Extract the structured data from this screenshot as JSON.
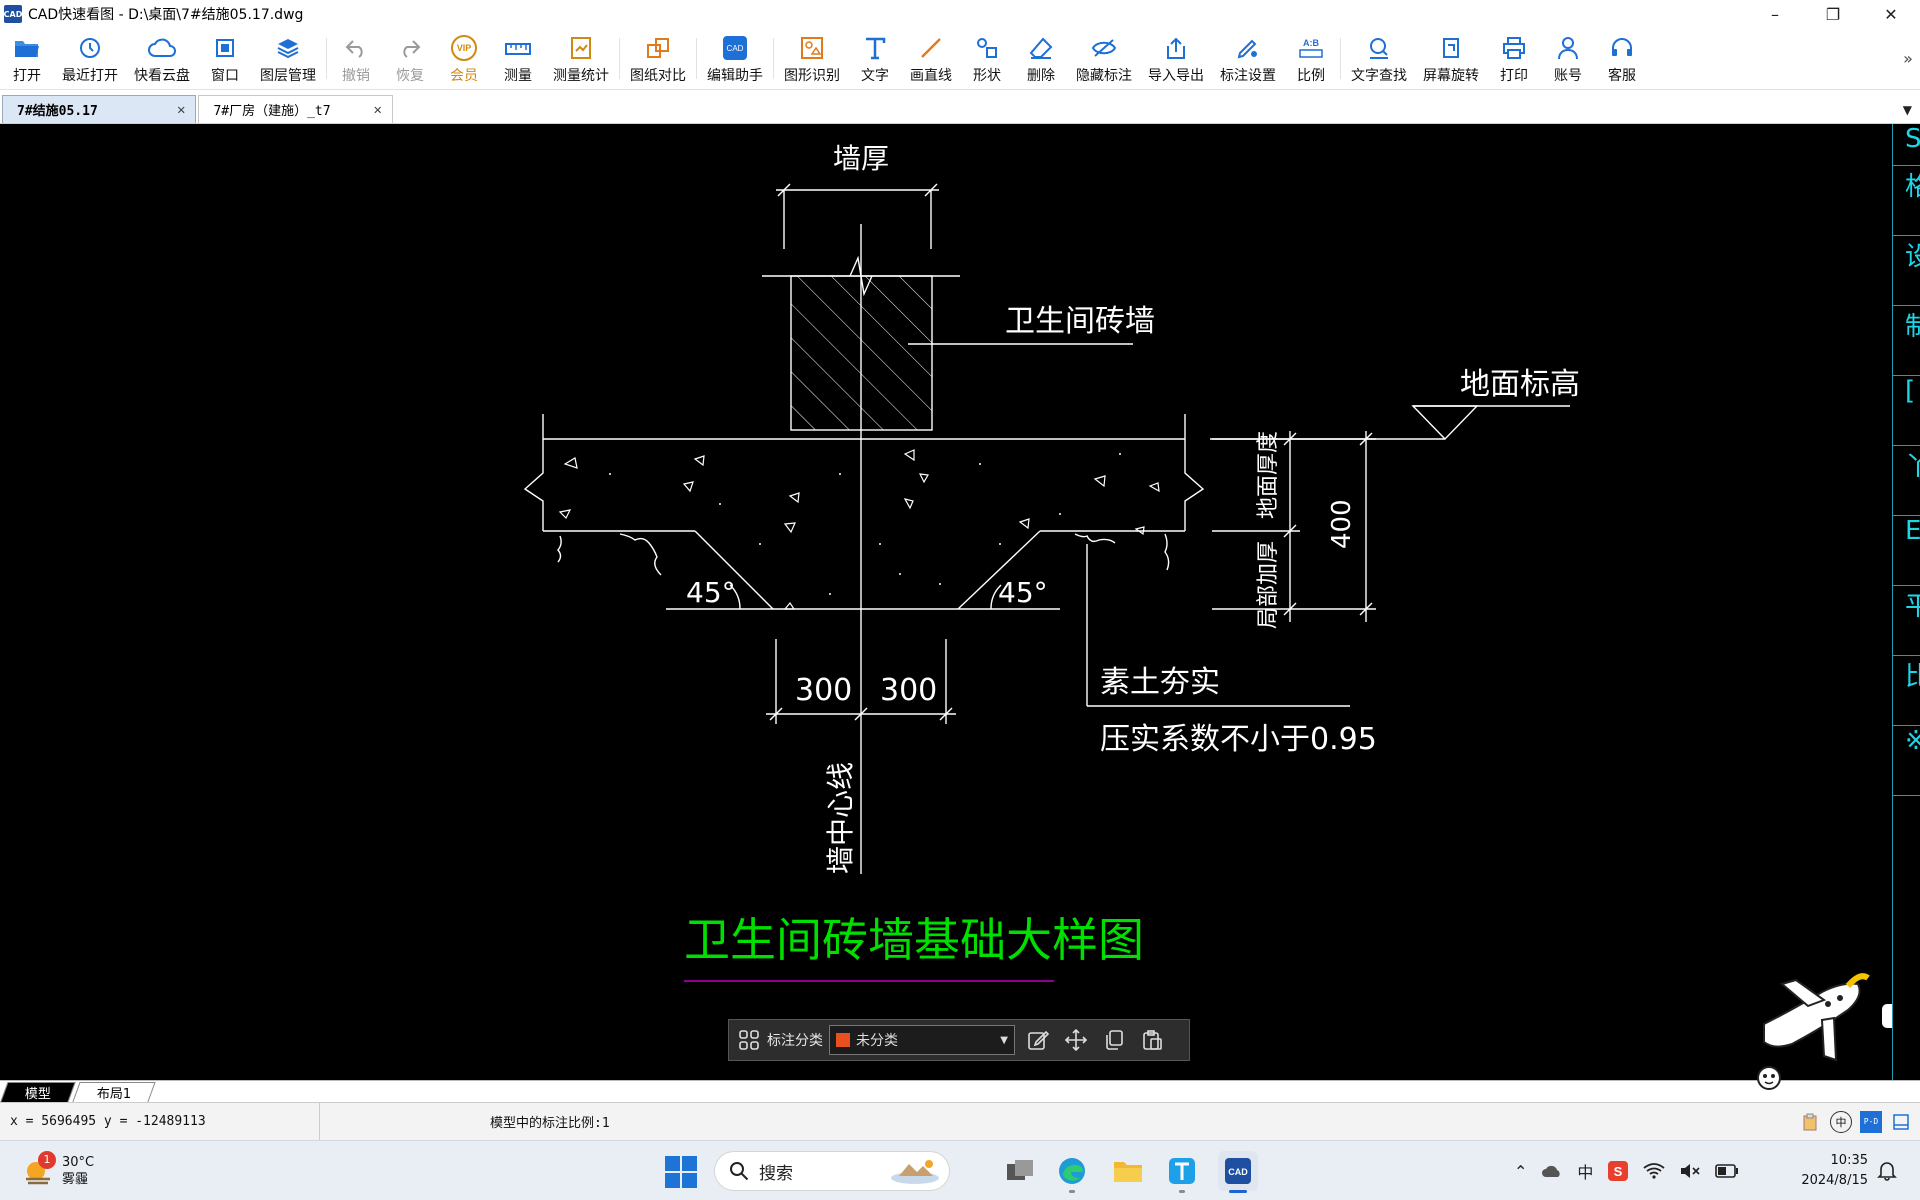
{
  "window": {
    "title": "CAD快速看图 - D:\\桌面\\7#结施05.17.dwg",
    "app_icon": "CAD"
  },
  "toolbar": {
    "items": [
      {
        "label": "打开",
        "icon": "folder-open-icon"
      },
      {
        "label": "最近打开",
        "icon": "history-icon"
      },
      {
        "label": "快看云盘",
        "icon": "cloud-icon"
      },
      {
        "label": "窗口",
        "icon": "window-icon"
      },
      {
        "label": "图层管理",
        "icon": "layers-icon"
      },
      {
        "label": "撤销",
        "icon": "undo-icon"
      },
      {
        "label": "恢复",
        "icon": "redo-icon"
      },
      {
        "label": "会员",
        "icon": "vip-icon"
      },
      {
        "label": "测量",
        "icon": "ruler-icon"
      },
      {
        "label": "测量统计",
        "icon": "measure-stats-icon"
      },
      {
        "label": "图纸对比",
        "icon": "compare-icon"
      },
      {
        "label": "编辑助手",
        "icon": "edit-assistant-icon"
      },
      {
        "label": "图形识别",
        "icon": "shape-recognize-icon"
      },
      {
        "label": "文字",
        "icon": "text-icon"
      },
      {
        "label": "画直线",
        "icon": "line-icon"
      },
      {
        "label": "形状",
        "icon": "shape-icon"
      },
      {
        "label": "删除",
        "icon": "eraser-icon"
      },
      {
        "label": "隐藏标注",
        "icon": "eye-hide-icon"
      },
      {
        "label": "导入导出",
        "icon": "import-export-icon"
      },
      {
        "label": "标注设置",
        "icon": "annotation-settings-icon"
      },
      {
        "label": "比例",
        "icon": "scale-icon"
      },
      {
        "label": "文字查找",
        "icon": "text-search-icon"
      },
      {
        "label": "屏幕旋转",
        "icon": "rotate-screen-icon"
      },
      {
        "label": "打印",
        "icon": "printer-icon"
      },
      {
        "label": "账号",
        "icon": "user-icon"
      },
      {
        "label": "客服",
        "icon": "headset-icon"
      }
    ],
    "vip_text": "VIP"
  },
  "tabs": [
    {
      "label": "7#结施05.17",
      "active": true
    },
    {
      "label": "7#厂房（建施）_t7",
      "active": false
    }
  ],
  "drawing": {
    "wall_thickness_label": "墙厚",
    "brick_wall_label": "卫生间砖墙",
    "ground_elevation_label": "地面标高",
    "ground_thickness_label": "地面厚度",
    "local_thickening_label": "局部加厚",
    "dim_400": "400",
    "angle_left": "45°",
    "angle_right": "45°",
    "dim_left_300": "300",
    "dim_right_300": "300",
    "wall_centerline_label": "墙中心线",
    "compacted_soil_label": "素土夯实",
    "compaction_label": "压实系数不小于0.95",
    "detail_title": "卫生间砖墙基础大样图"
  },
  "side_panel": [
    "S",
    "格C",
    "设D",
    "制D",
    "[",
    "丫",
    "E",
    "平I",
    "比S",
    "※"
  ],
  "annotation_bar": {
    "label": "标注分类",
    "selected": "未分类",
    "swatch_color": "#e8501e"
  },
  "layout_tabs": [
    {
      "label": "模型",
      "active": true
    },
    {
      "label": "布局1",
      "active": false
    }
  ],
  "status": {
    "coords": "x = 5696495  y = -12489113",
    "scale_text": "模型中的标注比例:1",
    "ime": "中"
  },
  "taskbar": {
    "weather_temp": "30°C",
    "weather_desc": "雾霾",
    "weather_badge": "1",
    "search_placeholder": "搜索",
    "tray_ime": "中",
    "time": "10:35",
    "date": "2024/8/15"
  },
  "colors": {
    "drawing_line": "#ffffff",
    "title_green": "#00e000",
    "title_underline": "#c000c0",
    "side_cyan": "#1fd6e6",
    "accent_blue": "#1e6fd6"
  }
}
